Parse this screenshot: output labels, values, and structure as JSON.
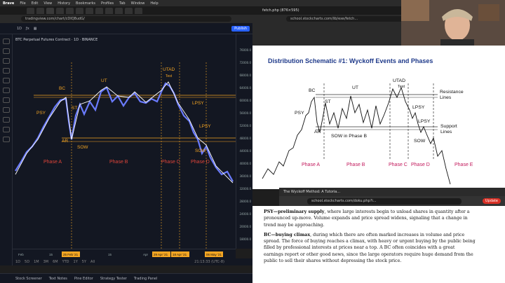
{
  "menubar": {
    "app": "Brave",
    "items": [
      "File",
      "Edit",
      "View",
      "History",
      "Bookmarks",
      "Profiles",
      "Tab",
      "Window",
      "Help"
    ]
  },
  "left_browser": {
    "url": "tradingview.com/chart/cDIQ8udG/"
  },
  "tradingview": {
    "symbol": "BTC Perpetual Futures Contract · 1D · BINANCE",
    "publish_label": "Publish",
    "prices": [
      "76000.0",
      "72000.0",
      "68000.0",
      "64000.0",
      "60000.0",
      "56000.0",
      "52000.0",
      "48000.0",
      "44000.0",
      "40000.0",
      "36000.0",
      "32000.0",
      "28000.0",
      "24000.0",
      "20000.0",
      "18000.0"
    ],
    "time_labels": [
      "Feb",
      "15",
      "25 Feb '21",
      "15",
      "Apr",
      "29 Apr '21",
      "18 Apr '21",
      "06 May '21"
    ],
    "bottom_ranges": [
      "1D",
      "5D",
      "1M",
      "3M",
      "6M",
      "YTD",
      "1Y",
      "5Y",
      "All"
    ],
    "time_readout": "21:13:33 (UTC-8)",
    "panels": [
      "Stock Screener",
      "Text Notes",
      "Pine Editor",
      "Strategy Tester",
      "Trading Panel"
    ],
    "annotations": {
      "bc": "BC",
      "psy": "PSY",
      "st": "ST",
      "ar": "AR",
      "sow": "SOW",
      "ut": "UT",
      "utad": "UTAD",
      "test": "Test",
      "lpsy": "LPSY",
      "sow2": "SOW",
      "phase_a": "Phase A",
      "phase_b": "Phase B",
      "phase_c": "Phase C",
      "phase_d": "Phase D"
    }
  },
  "right_browser": {
    "tab_url": "fetch.php (876×595)",
    "url": "school.stockcharts.com/lib/exe/fetch..."
  },
  "schematic": {
    "title": "Distribution Schematic #1: Wyckoff Events and Phases",
    "labels": {
      "utad": "UTAD",
      "test": "Test",
      "bc": "BC",
      "ut": "UT",
      "psy": "PSY",
      "st": "ST",
      "ar": "AR",
      "lpsy": "LPSY",
      "sow": "SOW",
      "sow_phase_b": "SOW in Phase B",
      "resistance": "Resistance",
      "lines": "Lines",
      "support": "Support",
      "lines2": "Lines",
      "phase_a": "Phase A",
      "phase_b": "Phase B",
      "phase_c": "Phase C",
      "phase_d": "Phase D",
      "phase_e": "Phase E"
    }
  },
  "overlay_browser": {
    "tab_title": "The Wyckoff Method: A Tutoria...",
    "url": "school.stockcharts.com/doku.php?i...",
    "update_label": "Update"
  },
  "article": {
    "psy_term": "PSY—preliminary supply",
    "psy_text": ", where large interests begin to unload shares in quantity after a pronounced up-move. Volume expands and price spread widens, signaling that a change in trend may be approaching.",
    "bc_term": "BC—buying climax",
    "bc_text": ", during which there are often marked increases in volume and price spread. The force of buying reaches a climax, with heavy or urgent buying by the public being filled by professional interests at prices near a top. A BC often coincides with a great earnings report or other good news, since the large operators require huge demand from the public to sell their shares without depressing the stock price."
  }
}
